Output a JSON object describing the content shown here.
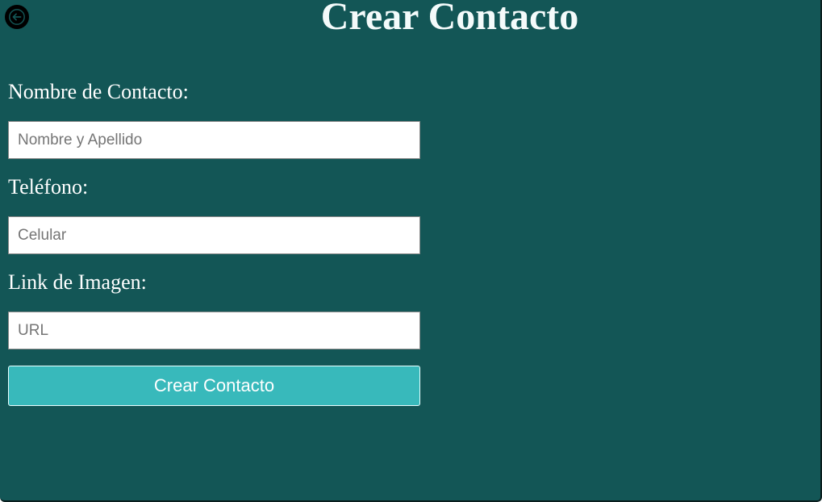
{
  "header": {
    "title": "Crear Contacto",
    "back_icon": "arrow-left-icon"
  },
  "form": {
    "name": {
      "label": "Nombre de Contacto:",
      "value": "",
      "placeholder": "Nombre y Apellido"
    },
    "phone": {
      "label": "Teléfono:",
      "value": "",
      "placeholder": "Celular"
    },
    "image": {
      "label": "Link de Imagen:",
      "value": "",
      "placeholder": "URL"
    },
    "submit_label": "Crear Contacto"
  },
  "colors": {
    "background": "#135656",
    "button": "#38b9bb",
    "text": "#ffffff"
  }
}
